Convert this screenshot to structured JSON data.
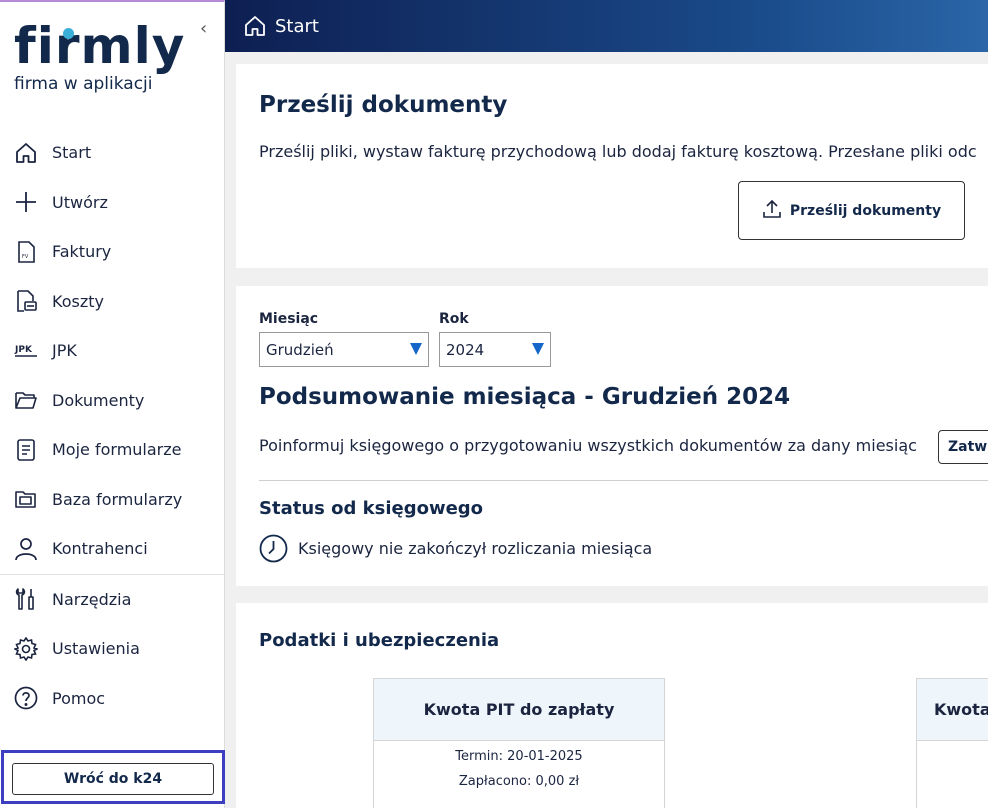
{
  "sidebar": {
    "logo_word": "firmly",
    "logo_sub": "firma w aplikacji",
    "collapse_glyph": "‹",
    "items": [
      {
        "label": "Start",
        "icon": "home-icon"
      },
      {
        "label": "Utwórz",
        "icon": "plus-icon"
      },
      {
        "label": "Faktury",
        "icon": "invoice-icon"
      },
      {
        "label": "Koszty",
        "icon": "costs-icon"
      },
      {
        "label": "JPK",
        "icon": "jpk-icon"
      },
      {
        "label": "Dokumenty",
        "icon": "folder-icon"
      },
      {
        "label": "Moje formularze",
        "icon": "form-icon"
      },
      {
        "label": "Baza formularzy",
        "icon": "forms-folder-icon"
      },
      {
        "label": "Kontrahenci",
        "icon": "person-icon"
      },
      {
        "label": "Narzędzia",
        "icon": "tools-icon"
      },
      {
        "label": "Ustawienia",
        "icon": "gear-icon"
      },
      {
        "label": "Pomoc",
        "icon": "help-icon"
      }
    ],
    "back_button": "Wróć do k24"
  },
  "topbar": {
    "title": "Start"
  },
  "upload": {
    "title": "Prześlij dokumenty",
    "description": "Prześlij pliki, wystaw fakturę przychodową lub dodaj fakturę kosztową. Przesłane pliki odc",
    "button": "Prześlij dokumenty"
  },
  "summary": {
    "month_label": "Miesiąc",
    "month_value": "Grudzień",
    "year_label": "Rok",
    "year_value": "2024",
    "title": "Podsumowanie miesiąca - Grudzień 2024",
    "inform_text": "Poinformuj księgowego o przygotowaniu wszystkich dokumentów za dany miesiąc",
    "confirm_button": "Zatwie",
    "status_title": "Status od księgowego",
    "status_text": "Księgowy nie zakończył rozliczania miesiąca"
  },
  "taxes": {
    "title": "Podatki i ubezpieczenia",
    "pit": {
      "header": "Kwota PIT do zapłaty",
      "deadline": "Termin: 20-01-2025",
      "paid": "Zapłacono: 0,00 zł"
    },
    "second_header": "Kwota"
  },
  "colors": {
    "navy": "#13294b",
    "accent_blue": "#1566c8",
    "logo_dot": "#3ab0d9",
    "highlight_border": "#3d3fc0"
  }
}
